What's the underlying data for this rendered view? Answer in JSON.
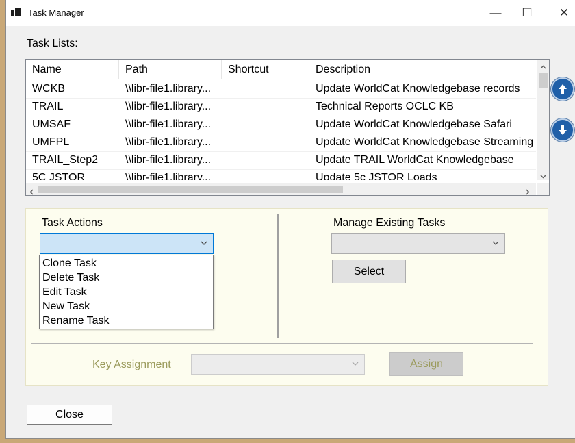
{
  "window": {
    "title": "Task Manager",
    "minimize_glyph": "—",
    "maximize_glyph": "☐",
    "close_glyph": "✕"
  },
  "task_lists": {
    "label": "Task Lists:",
    "columns": [
      "Name",
      "Path",
      "Shortcut",
      "Description"
    ],
    "rows": [
      {
        "name": "WCKB",
        "path": "\\\\libr-file1.library...",
        "shortcut": "",
        "description": "Update WorldCat Knowledgebase records"
      },
      {
        "name": "TRAIL",
        "path": "\\\\libr-file1.library...",
        "shortcut": "",
        "description": "Technical Reports OCLC KB"
      },
      {
        "name": "UMSAF",
        "path": "\\\\libr-file1.library...",
        "shortcut": "",
        "description": "Update WorldCat Knowledgebase Safari"
      },
      {
        "name": "UMFPL",
        "path": "\\\\libr-file1.library...",
        "shortcut": "",
        "description": "Update WorldCat Knowledgebase Streaming"
      },
      {
        "name": "TRAIL_Step2",
        "path": "\\\\libr-file1.library...",
        "shortcut": "",
        "description": "Update TRAIL WorldCat Knowledgebase"
      },
      {
        "name": "5C JSTOR",
        "path": "\\\\libr-file1.library...",
        "shortcut": "",
        "description": "Update 5c JSTOR Loads"
      }
    ]
  },
  "side_buttons": {
    "up_icon": "arrow-up-icon",
    "down_icon": "arrow-down-icon"
  },
  "task_actions": {
    "label": "Task Actions",
    "selected_value": "",
    "options": [
      "Clone Task",
      "Delete Task",
      "Edit Task",
      "New Task",
      "Rename Task"
    ]
  },
  "manage_existing": {
    "label": "Manage Existing Tasks",
    "selected_value": "",
    "select_button": "Select"
  },
  "key_assignment": {
    "label": "Key Assignment",
    "selected_value": "",
    "assign_button": "Assign"
  },
  "footer": {
    "close_button": "Close"
  },
  "colors": {
    "accent_blue": "#1f5fa8",
    "dropdown_focus": "#cce4f7",
    "panel_bg": "#fdfdef",
    "disabled_text": "#9b9b5c"
  }
}
